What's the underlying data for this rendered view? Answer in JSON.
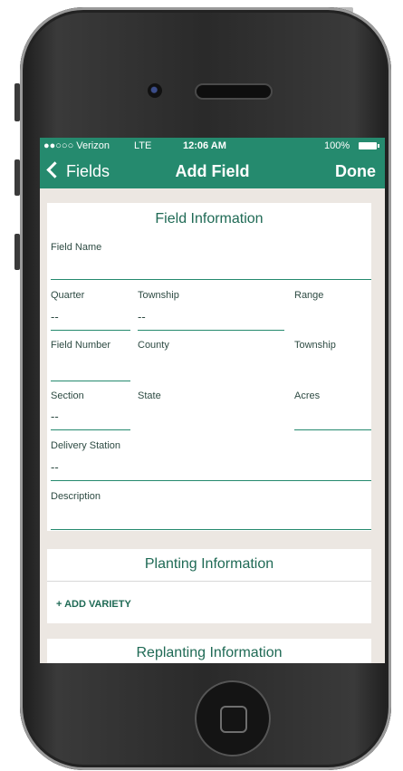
{
  "status_bar": {
    "carrier": "●●○○○ Verizon",
    "network": "LTE",
    "time": "12:06 AM",
    "battery": "100%"
  },
  "nav": {
    "back_label": "Fields",
    "title": "Add Field",
    "done_label": "Done"
  },
  "field_info": {
    "title": "Field Information",
    "field_name_label": "Field Name",
    "quarter_label": "Quarter",
    "quarter_value": "--",
    "township_label": "Township",
    "township_value": "--",
    "range_label": "Range",
    "field_number_label": "Field Number",
    "county_label": "County",
    "township2_label": "Township",
    "section_label": "Section",
    "section_value": "--",
    "state_label": "State",
    "acres_label": "Acres",
    "delivery_label": "Delivery Station",
    "delivery_value": "--",
    "description_label": "Description"
  },
  "planting": {
    "title": "Planting Information",
    "add_label": "+ ADD VARIETY"
  },
  "replanting": {
    "title": "Replanting Information"
  },
  "colors": {
    "accent": "#258a6e",
    "background": "#ece7e2"
  }
}
